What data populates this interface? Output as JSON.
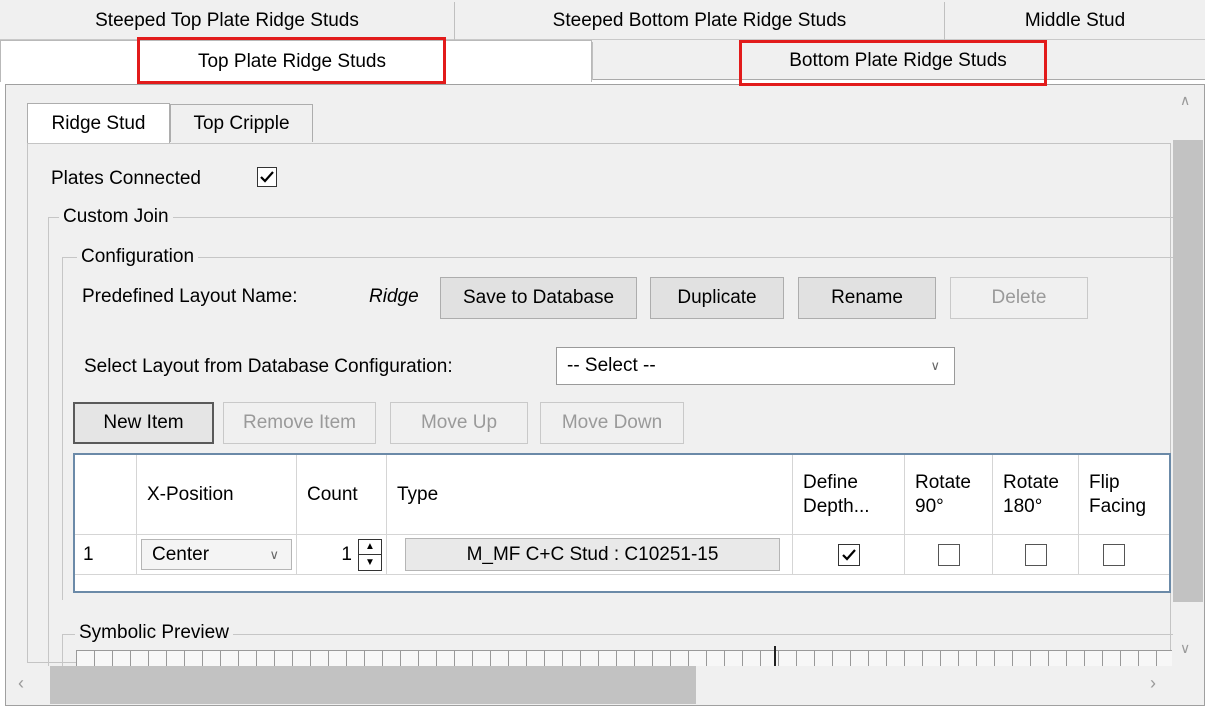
{
  "top_tabs_row1": [
    "Steeped Top Plate Ridge Studs",
    "Steeped Bottom Plate Ridge Studs",
    "Middle Stud"
  ],
  "top_tabs_row2": [
    "Top Plate Ridge Studs",
    "Bottom Plate Ridge Studs"
  ],
  "sub_tabs": [
    "Ridge Stud",
    "Top Cripple"
  ],
  "plates_connected": {
    "label": "Plates Connected",
    "checked": true
  },
  "custom_join_label": "Custom Join",
  "configuration": {
    "label": "Configuration",
    "predefined_label": "Predefined Layout Name:",
    "predefined_value": "Ridge",
    "buttons": {
      "save": "Save to Database",
      "duplicate": "Duplicate",
      "rename": "Rename",
      "delete": "Delete"
    },
    "select_label": "Select Layout from Database Configuration:",
    "select_value": "-- Select --"
  },
  "item_buttons": {
    "new": "New Item",
    "remove": "Remove Item",
    "move_up": "Move Up",
    "move_down": "Move Down"
  },
  "grid": {
    "headers": {
      "x_position": "X-Position",
      "count": "Count",
      "type": "Type",
      "define_depth": "Define Depth...",
      "rotate90": "Rotate 90°",
      "rotate180": "Rotate 180°",
      "flip_facing": "Flip Facing"
    },
    "row": {
      "index": "1",
      "x_position": "Center",
      "count": "1",
      "type": "M_MF C+C Stud : C10251-15",
      "define_depth": true,
      "rotate90": false,
      "rotate180": false,
      "flip_facing": false
    }
  },
  "symbolic_preview_label": "Symbolic Preview",
  "colors": {
    "highlight": "#e21b1b",
    "grid_border": "#6b8aa8"
  }
}
